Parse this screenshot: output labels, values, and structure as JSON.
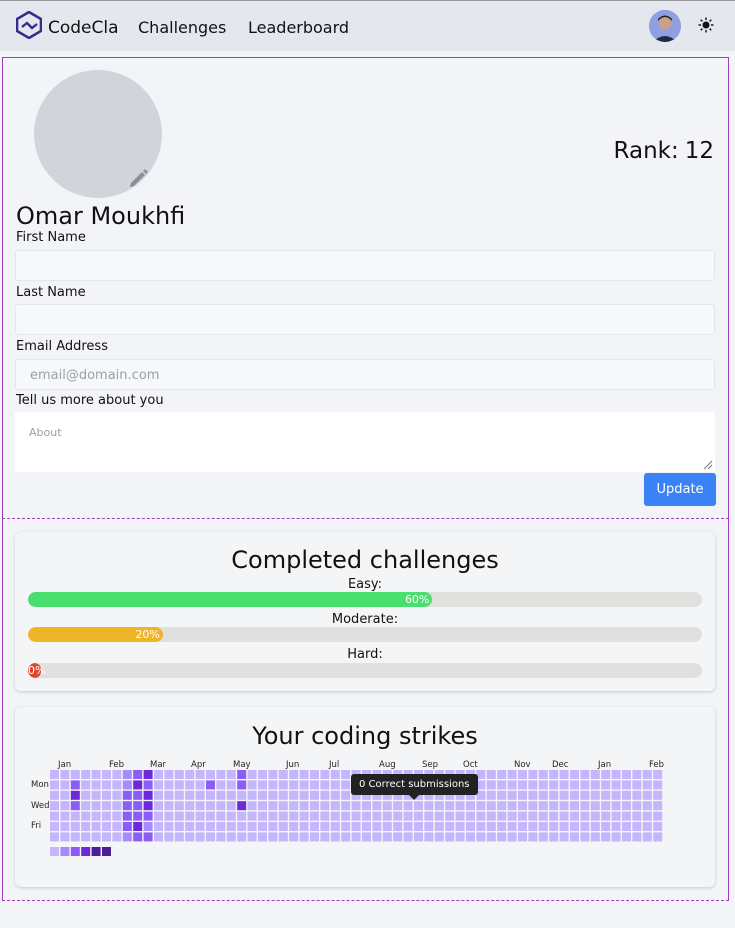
{
  "nav": {
    "brand": "CodeCla",
    "links": [
      "Challenges",
      "Leaderboard"
    ]
  },
  "profile": {
    "rank_label": "Rank:",
    "rank_value": "12",
    "full_name": "Omar Moukhfi",
    "first_name_label": "First Name",
    "first_name_value": "",
    "last_name_label": "Last Name",
    "last_name_value": "",
    "email_label": "Email Address",
    "email_placeholder": "email@domain.com",
    "about_label": "Tell us more about you",
    "about_placeholder": "About",
    "update_label": "Update"
  },
  "completed": {
    "title": "Completed challenges",
    "bars": [
      {
        "label": "Easy:",
        "value": 60,
        "text": "60%",
        "color": "#4ade6e"
      },
      {
        "label": "Moderate:",
        "value": 20,
        "text": "20%",
        "color": "#f0b429"
      },
      {
        "label": "Hard:",
        "value": 0,
        "text": "0%",
        "color": "#e0462c"
      }
    ]
  },
  "strikes": {
    "title": "Your coding strikes",
    "months": [
      "Jan",
      "Feb",
      "Mar",
      "Apr",
      "May",
      "Jun",
      "Jul",
      "Aug",
      "Sep",
      "Oct",
      "Nov",
      "Dec",
      "Jan",
      "Feb"
    ],
    "days": [
      "Mon",
      "Wed",
      "Fri"
    ],
    "tooltip": "0 Correct submissions",
    "legend_levels": 4,
    "colors": {
      "empty": "#c4b5fd",
      "l1": "#a78bfa",
      "l2": "#8b5cf6",
      "l3": "#6d28d9",
      "l4": "#4c1d95"
    }
  }
}
